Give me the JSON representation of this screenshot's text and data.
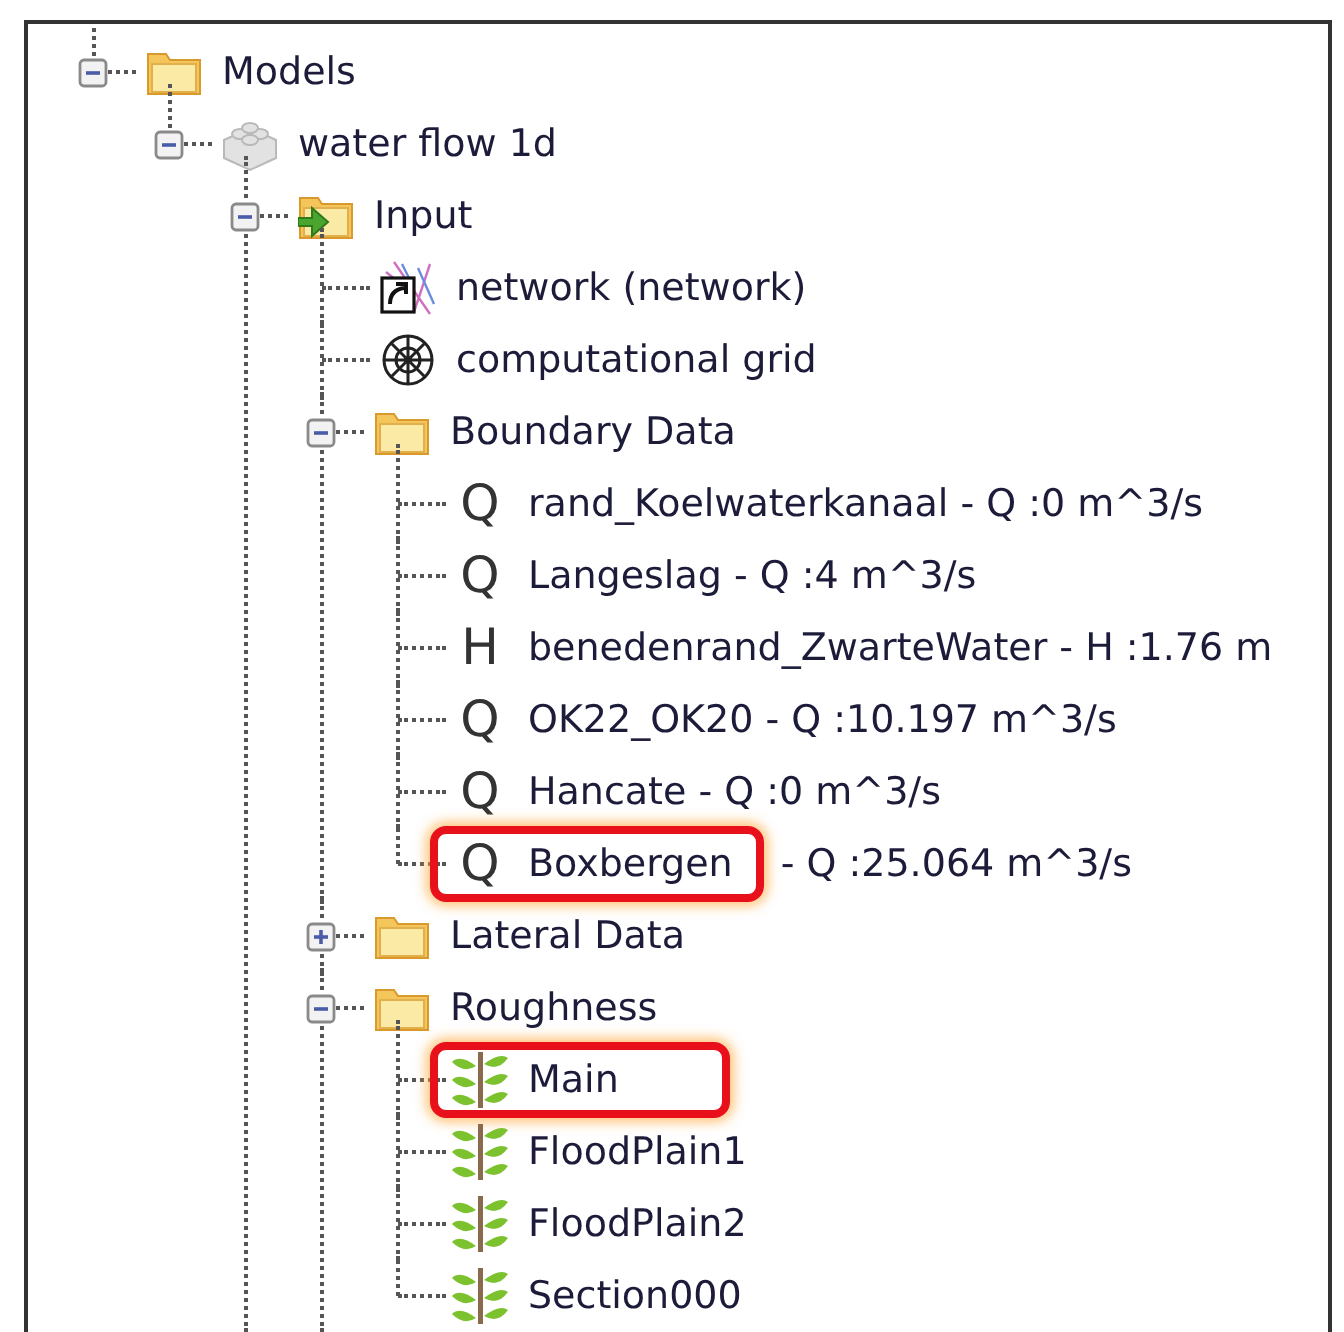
{
  "tree": [
    {
      "label": "Models",
      "kind": "folder",
      "expanded": true,
      "children": [
        {
          "label": "water flow 1d",
          "kind": "model",
          "expanded": true,
          "more_below": true,
          "children": [
            {
              "label": "Input",
              "kind": "input-folder",
              "expanded": true,
              "more_below": true,
              "children": [
                {
                  "label": "network (network)",
                  "kind": "network"
                },
                {
                  "label": "computational grid",
                  "kind": "grid"
                },
                {
                  "label": "Boundary Data",
                  "kind": "folder",
                  "expanded": true,
                  "children": [
                    {
                      "label": "rand_Koelwaterkanaal - Q :0 m^3/s",
                      "kind": "symbol",
                      "symbol": "Q",
                      "highlighted": false
                    },
                    {
                      "label": "Langeslag - Q :4 m^3/s",
                      "kind": "symbol",
                      "symbol": "Q",
                      "highlighted": false
                    },
                    {
                      "label": "benedenrand_ZwarteWater - H :1.76 m",
                      "kind": "symbol",
                      "symbol": "H",
                      "highlighted": false
                    },
                    {
                      "label": "OK22_OK20 - Q :10.197 m^3/s",
                      "kind": "symbol",
                      "symbol": "Q",
                      "highlighted": false
                    },
                    {
                      "label": "Hancate - Q :0 m^3/s",
                      "kind": "symbol",
                      "symbol": "Q",
                      "highlighted": false
                    },
                    {
                      "label": "Boxbergen",
                      "suffix": "- Q :25.064 m^3/s",
                      "kind": "symbol",
                      "symbol": "Q",
                      "highlighted": true
                    }
                  ]
                },
                {
                  "label": "Lateral Data",
                  "kind": "folder",
                  "expanded": false
                },
                {
                  "label": "Roughness",
                  "kind": "folder",
                  "expanded": true,
                  "children": [
                    {
                      "label": "Main",
                      "kind": "plant",
                      "highlighted": true
                    },
                    {
                      "label": "FloodPlain1",
                      "kind": "plant",
                      "highlighted": false
                    },
                    {
                      "label": "FloodPlain2",
                      "kind": "plant",
                      "highlighted": false
                    },
                    {
                      "label": "Section000",
                      "kind": "plant",
                      "highlighted": false
                    }
                  ]
                }
              ]
            }
          ]
        }
      ]
    }
  ]
}
